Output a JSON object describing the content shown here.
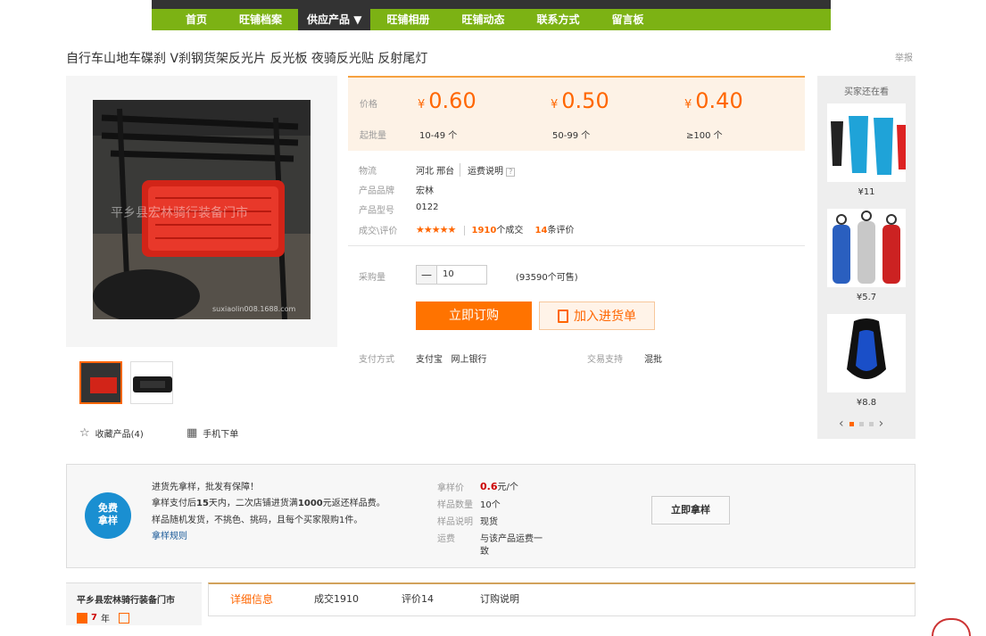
{
  "nav": {
    "items": [
      "首页",
      "旺铺档案",
      "供应产品 ▼",
      "旺铺相册",
      "旺铺动态",
      "联系方式",
      "留言板"
    ]
  },
  "product": {
    "title": "自行车山地车碟刹 V刹钢货架反光片 反光板 夜骑反光贴 反射尾灯",
    "report": "举报",
    "watermark": "平乡县宏林骑行装备门市",
    "watermark_url": "suxiaolin008.1688.com"
  },
  "price": {
    "price_label": "价格",
    "moq_label": "起批量",
    "currency": "¥",
    "tiers": [
      {
        "price": "0.60",
        "qty": "10-49 个"
      },
      {
        "price": "0.50",
        "qty": "50-99 个"
      },
      {
        "price": "0.40",
        "qty": "≥100 个"
      }
    ]
  },
  "info": {
    "logistics_label": "物流",
    "logistics_value": "河北 邢台",
    "freight_link": "运费说明",
    "brand_label": "产品品牌",
    "brand_value": "宏林",
    "model_label": "产品型号",
    "model_value": "0122",
    "deals_label": "成交\\评价",
    "stars": "★★★★★",
    "deals_count": "1910",
    "deals_suffix": "个成交",
    "reviews_count": "14",
    "reviews_suffix": "条评价"
  },
  "purchase": {
    "qty_label": "采购量",
    "minus": "—",
    "qty_value": "10",
    "available": "(93590个可售)",
    "order_button": "立即订购",
    "cart_button": "加入进货单",
    "payment_label": "支付方式",
    "payment_value": "支付宝   网上银行",
    "trade_label": "交易支持",
    "trade_value": "混批"
  },
  "gallery": {
    "fav_label": "收藏产品(4)",
    "mobile_label": "手机下单"
  },
  "rail": {
    "title": "买家还在看",
    "items": [
      {
        "price": "¥11"
      },
      {
        "price": "¥5.7"
      },
      {
        "price": "¥8.8"
      }
    ]
  },
  "sample": {
    "badge_line1": "免费",
    "badge_line2": "拿样",
    "line1": "进货先拿样，批发有保障！",
    "line2_pre": "拿样支付后",
    "line2_days": "15",
    "line2_mid": "天内，二次店铺进货满",
    "line2_amount": "1000",
    "line2_post": "元返还样品费。",
    "line3": "样品随机发货，不挑色、挑码，且每个买家限购1件。",
    "rules_link": "拿样规则",
    "price_label": "拿样价",
    "price_value": "0.6",
    "price_unit": "元/个",
    "qty_label": "样品数量",
    "qty_value": "10个",
    "desc_label": "样品说明",
    "desc_value": "现货",
    "freight_label": "运费",
    "freight_value_1": "与该产品运费一",
    "freight_value_2": "致",
    "button": "立即拿样"
  },
  "shop": {
    "name": "平乡县宏林骑行装备门市",
    "years": "7",
    "years_unit": "年"
  },
  "tabs": [
    "详细信息",
    "成交1910",
    "评价14",
    "订购说明"
  ],
  "colors": {
    "nav_green": "#7cb214",
    "accent_orange": "#ff7300",
    "price_bg": "#fdf2e6",
    "link_blue": "#1a5a99",
    "badge_blue": "#1a8fd1"
  }
}
